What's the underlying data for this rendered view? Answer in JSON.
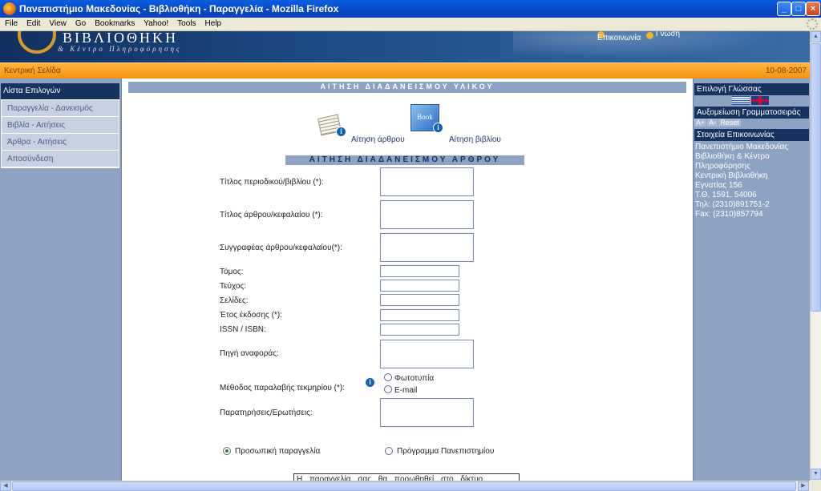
{
  "window": {
    "title": "Πανεπιστήμιο Μακεδονίας - Βιβλιοθήκη - Παραγγελία - Mozilla Firefox",
    "min_label": "_",
    "max_label": "□",
    "close_label": "×"
  },
  "menu": [
    "File",
    "Edit",
    "View",
    "Go",
    "Bookmarks",
    "Yahoo!",
    "Tools",
    "Help"
  ],
  "banner": {
    "logo_title": "ΒΙΒΛΙΟΘΗΚΗ",
    "logo_sub": "& Κέντρο Πληροφόρησης",
    "nav_contact": "Επικοινωνία",
    "nav_knowledge": "Γνωση"
  },
  "breadcrumb": {
    "home": "Κεντρική Σελίδα",
    "date": "10-08-2007"
  },
  "left_menu": {
    "title": "Λίστα Επιλογών",
    "items": [
      "Παραγγελία - Δανεισμός",
      "Βιβλία - Αιτήσεις",
      "Άρθρα - Αιτήσεις",
      "Αποσύνδεση"
    ]
  },
  "right_panel": {
    "language_title": "Επιλογή Γλώσσας",
    "font_title": "Αυξομείωση Γραμματοσειράς",
    "font_plus": "A+",
    "font_minus": "A-",
    "font_reset": "Reset",
    "contact_title": "Στοιχεία Επικοινωνίας",
    "contact_lines": [
      "Πανεπιστήμιο Μακεδονίας",
      "Βιβλιοθήκη & Κέντρο",
      "Πληροφόρησης",
      "Κεντρική Βιβλιοθήκη",
      "Εγνατίας 156",
      "Τ.Θ. 1591, 54006",
      "Τηλ: (2310)891751-2",
      "Fax: (2310)857794"
    ]
  },
  "main": {
    "header": "ΑΙΤΗΣΗ ΔΙΑΔΑΝΕΙΣΜΟΥ ΥΛΙΚΟΥ",
    "article_request": "Αίτηση άρθρου",
    "book_request": "Αίτηση βιβλίου",
    "book_icon_text": "Book",
    "info_glyph": "i",
    "section_title": "ΑΙΤΗΣΗ ΔΙΑΔΑΝΕΙΣΜΟΥ ΑΡΘΡΟΥ",
    "fields": {
      "journal_title": "Τίτλος περιοδικού/βιβλίου (*):",
      "article_title": "Τίτλος άρθρου/κεφαλαίου (*):",
      "author": "Συγγραφέας άρθρου/κεφαλαίου(*):",
      "volume": "Τόμος:",
      "issue": "Τεύχος:",
      "pages": "Σελίδες:",
      "year": "Έτος έκδοσης (*):",
      "issn": "ISSN / ISBN:",
      "source": "Πηγή αναφοράς:",
      "delivery_method": "Μέθοδος παραλαβής τεκμηρίου (*):",
      "notes": "Παρατηρήσεις/Ερωτήσεις:"
    },
    "delivery_options": [
      "Φωτοτυπία",
      "E-mail"
    ],
    "order_options": [
      "Προσωπική παραγγελία",
      "Πρόγραμμα Πανεπιστημίου"
    ],
    "notice": "Η παραγγελία σας θα προωθηθεί στο δίκτυο"
  }
}
